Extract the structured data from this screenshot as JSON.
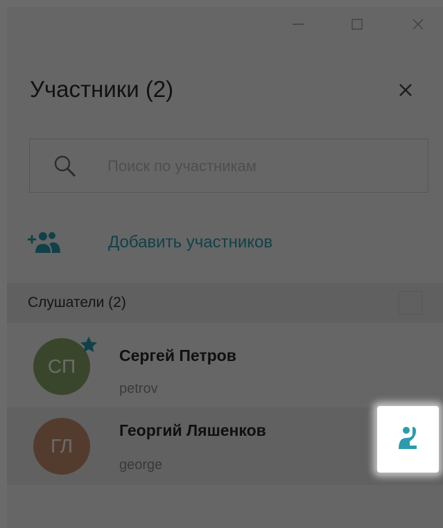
{
  "window": {
    "controls": {
      "minimize_icon": "minimize-icon",
      "maximize_icon": "maximize-icon",
      "close_icon": "close-icon"
    }
  },
  "panel": {
    "title": "Участники (2)",
    "close_icon": "close-icon"
  },
  "search": {
    "placeholder": "Поиск по участникам",
    "value": "",
    "icon": "search-icon"
  },
  "add_participants": {
    "label": "Добавить участников",
    "icon": "add-user-icon"
  },
  "section": {
    "label": "Слушатели (2)"
  },
  "participants": [
    {
      "initials": "СП",
      "name": "Сергей Петров",
      "login": "petrov",
      "avatar_color": "#8aa868",
      "is_owner": true
    },
    {
      "initials": "ГЛ",
      "name": "Георгий Ляшенков",
      "login": "george",
      "avatar_color": "#c68f6f",
      "raised_hand": true
    }
  ],
  "colors": {
    "accent": "#2a9cad",
    "overlay": "rgba(0,0,0,0.58)"
  }
}
